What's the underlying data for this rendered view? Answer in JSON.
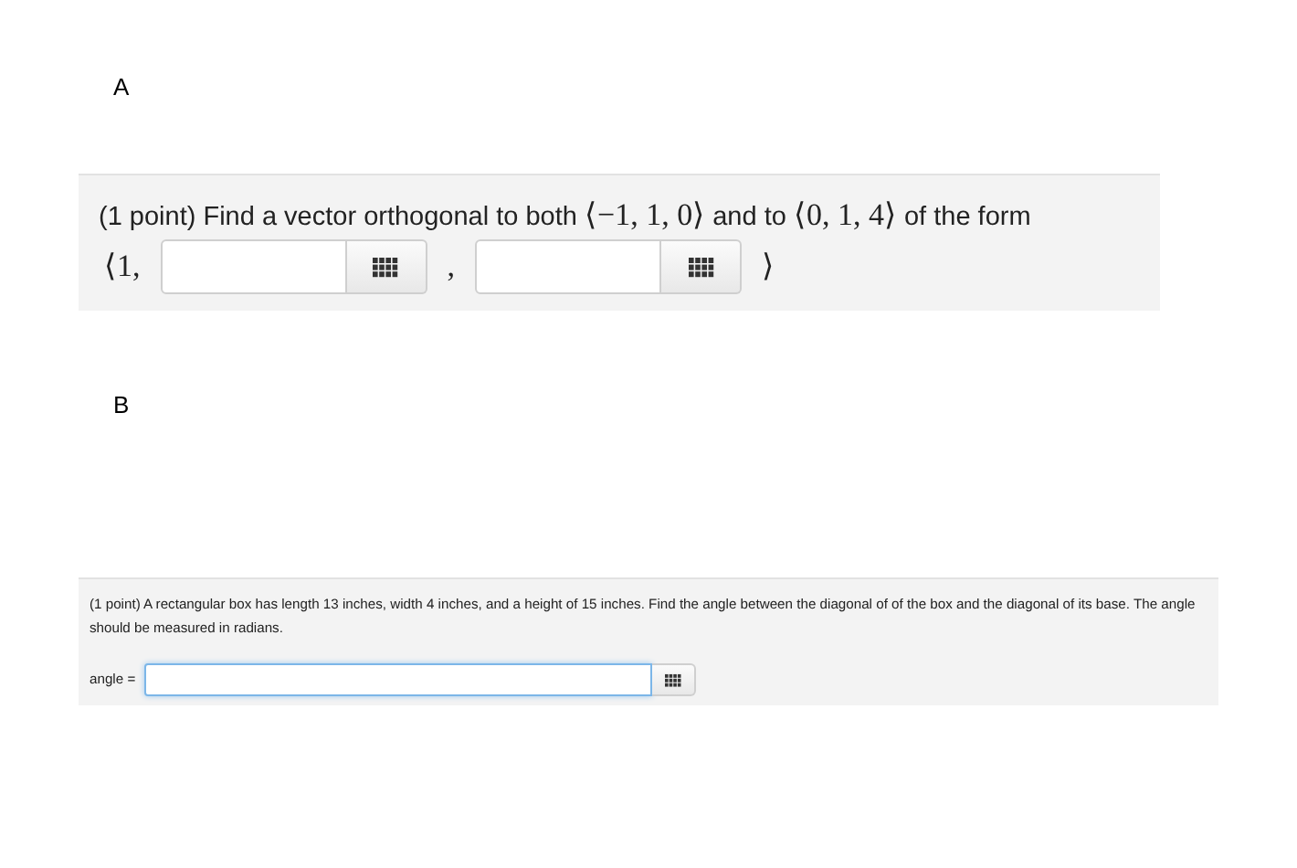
{
  "problems": [
    {
      "label": "A",
      "question": [
        {
          "kind": "text",
          "text": "(1 point) Find a vector orthogonal to both "
        },
        {
          "kind": "math",
          "text": "⟨−1, 1, 0⟩"
        },
        {
          "kind": "text",
          "text": " and to "
        },
        {
          "kind": "math",
          "text": "⟨0, 1, 4⟩"
        },
        {
          "kind": "text",
          "text": " of the form"
        }
      ],
      "answer_row": [
        {
          "kind": "math",
          "text": "⟨1,"
        },
        {
          "kind": "input",
          "focused": false
        },
        {
          "kind": "math",
          "text": ","
        },
        {
          "kind": "input",
          "focused": false
        },
        {
          "kind": "math",
          "text": "⟩"
        }
      ]
    },
    {
      "label": "B",
      "question": [
        {
          "kind": "text",
          "text": "(1 point) A rectangular box has length 13 inches, width 4 inches, and a height of 15 inches. Find the angle between the diagonal of of the box and the diagonal of its base. The angle should be measured in radians."
        }
      ],
      "answer_row": [
        {
          "kind": "text",
          "text": "angle ="
        },
        {
          "kind": "input",
          "focused": true
        }
      ]
    }
  ]
}
